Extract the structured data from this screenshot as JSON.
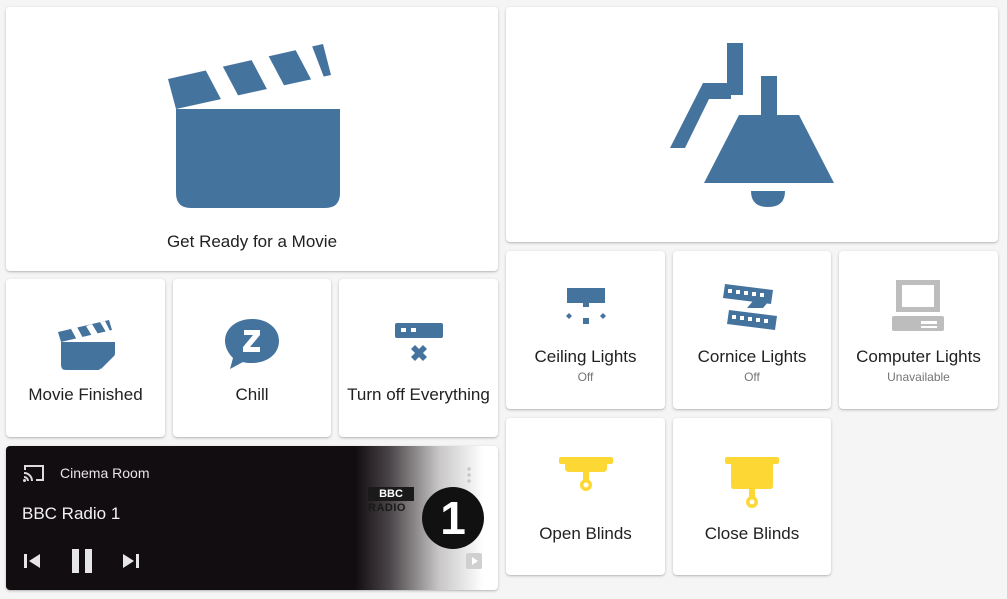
{
  "colors": {
    "icon_blue": "#44739e",
    "icon_yellow": "#fdd835",
    "icon_grey": "#bdbdbd",
    "media_bg": "#120d10"
  },
  "scenes": {
    "movie": {
      "label": "Get Ready for a Movie",
      "icon": "clapperboard-icon"
    },
    "bell": {
      "label": "",
      "icon": "ceiling-lamp-icon"
    },
    "movie_finished": {
      "label": "Movie Finished",
      "icon": "clapperboard-check-icon"
    },
    "chill": {
      "label": "Chill",
      "icon": "chat-z-icon"
    },
    "turn_off": {
      "label": "Turn off Everything",
      "icon": "strip-off-icon"
    }
  },
  "lights": [
    {
      "label": "Ceiling Lights",
      "state": "Off",
      "icon": "ceiling-light-icon"
    },
    {
      "label": "Cornice Lights",
      "state": "Off",
      "icon": "led-strip-icon"
    },
    {
      "label": "Computer Lights",
      "state": "Unavailable",
      "icon": "desktop-classic-icon"
    }
  ],
  "blinds": {
    "open": {
      "label": "Open Blinds",
      "icon": "blinds-open-icon"
    },
    "close": {
      "label": "Close Blinds",
      "icon": "blinds-closed-icon"
    }
  },
  "media": {
    "room": "Cinema Room",
    "track": "BBC Radio 1",
    "logo_line1": "BBC",
    "logo_line2": "RADIO",
    "logo_number": "1",
    "icons": [
      "cast-icon",
      "skip-previous-icon",
      "pause-icon",
      "skip-next-icon",
      "more-vert-icon",
      "play-box-icon"
    ]
  }
}
